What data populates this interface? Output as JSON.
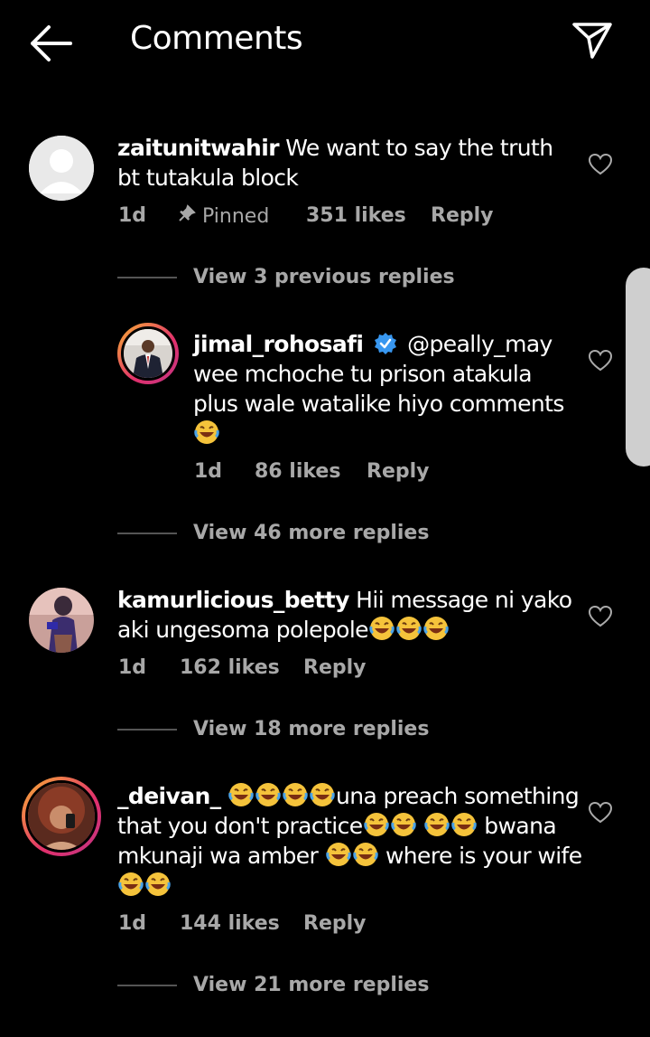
{
  "header": {
    "title": "Comments",
    "back_icon": "arrow-left-icon",
    "send_icon": "paper-plane-icon"
  },
  "comments": [
    {
      "username": "zaitunitwahir",
      "text": "We want to say the truth bt tutakula block",
      "time": "1d",
      "pinned_label": "Pinned",
      "likes": "351 likes",
      "reply": "Reply",
      "view_replies": "View 3 previous replies"
    },
    {
      "username": "jimal_rohosafi",
      "verified": true,
      "mention": "@peally_may",
      "text": "wee mchoche tu prison atakula plus wale watalike hiyo comments",
      "time": "1d",
      "likes": "86 likes",
      "reply": "Reply",
      "view_replies": "View 46 more replies"
    },
    {
      "username": "kamurlicious_betty",
      "text": "Hii message ni yako aki ungesoma polepole",
      "time": "1d",
      "likes": "162 likes",
      "reply": "Reply",
      "view_replies": "View 18 more replies"
    },
    {
      "username": "_deivan_",
      "text1": "una preach something that you don't practice",
      "text2": "bwana mkunaji wa amber",
      "text3": "where is your wife",
      "time": "1d",
      "likes": "144 likes",
      "reply": "Reply",
      "view_replies": "View 21 more replies"
    }
  ],
  "colors": {
    "background": "#000000",
    "text": "#ffffff",
    "muted": "#a8a8a8",
    "verified": "#3897f0"
  }
}
